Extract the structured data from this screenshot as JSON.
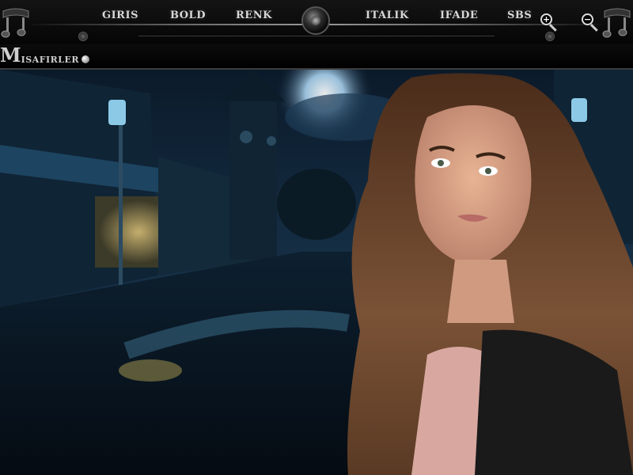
{
  "toolbar": {
    "items": [
      "GIRIS",
      "BOLD",
      "RENK",
      "ITALIK",
      "IFADE",
      "SBS"
    ],
    "zoom_in_symbol": "+",
    "zoom_out_symbol": "−"
  },
  "guests": {
    "label_first": "M",
    "label_rest": "ISAFIRLER"
  },
  "icons": {
    "corner": "music-note-icon",
    "knob": "dial-knob-icon",
    "zoom_in": "zoom-in-icon",
    "zoom_out": "zoom-out-icon",
    "guests": "globe-icon"
  },
  "colors": {
    "bar_bg": "#0a0a0a",
    "text": "#d8d8d8",
    "sky": "#163047",
    "street_light": "#e6c86a"
  }
}
